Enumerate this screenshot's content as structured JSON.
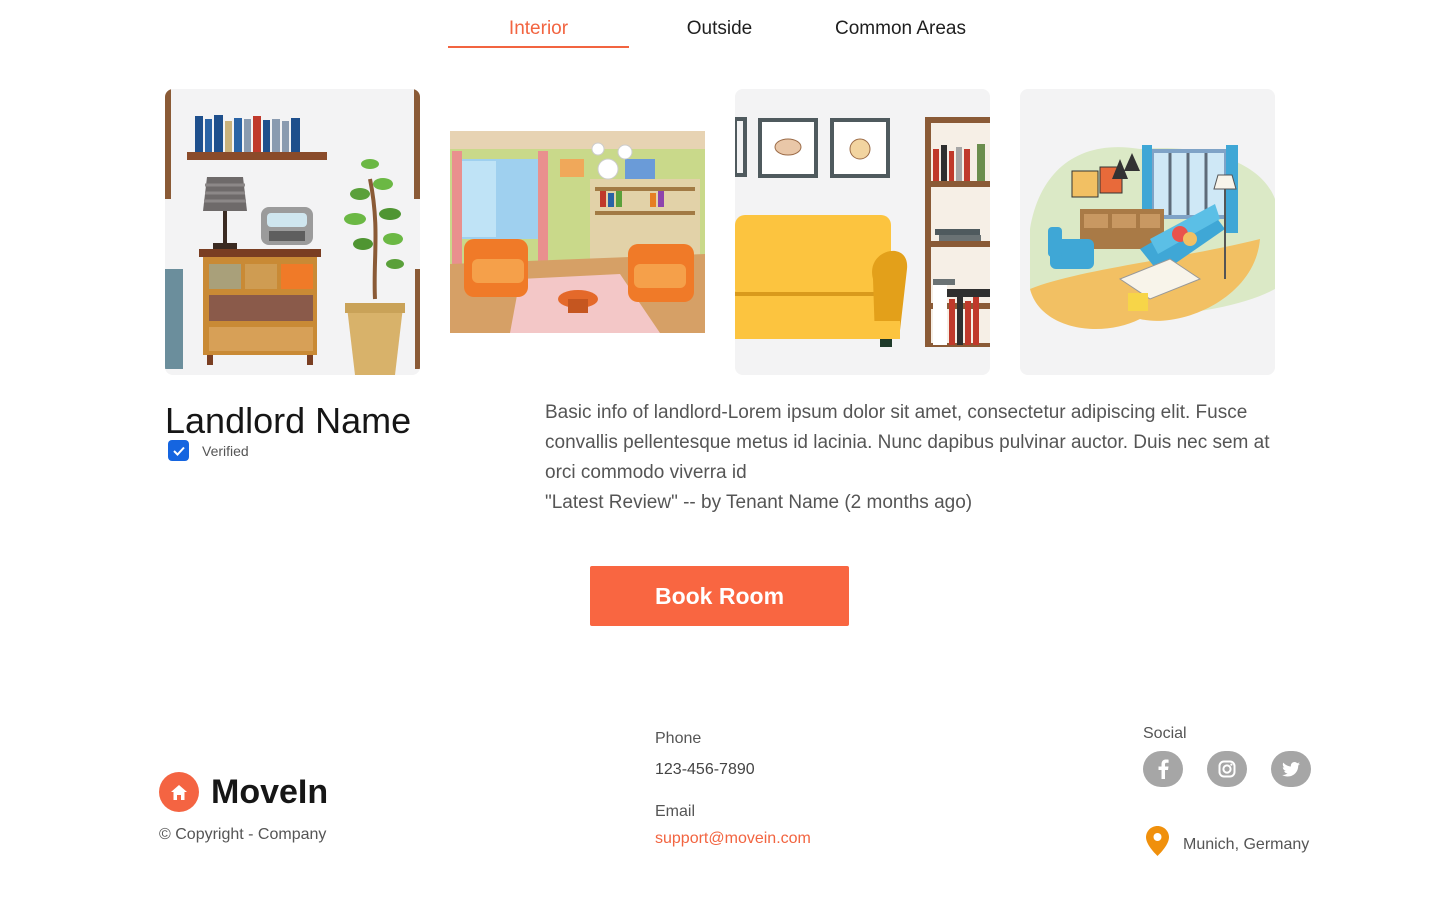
{
  "tabs": [
    {
      "label": "Interior",
      "active": true
    },
    {
      "label": "Outside",
      "active": false
    },
    {
      "label": "Common Areas",
      "active": false
    }
  ],
  "landlord": {
    "name": "Landlord Name",
    "verified": true,
    "verified_label": "Verified",
    "info": "Basic info of landlord-Lorem ipsum dolor sit amet, consectetur adipiscing elit. Fusce convallis pellentesque metus id lacinia. Nunc dapibus pulvinar auctor. Duis nec sem at orci commodo viverra id",
    "review": "\"Latest Review\" -- by Tenant Name (2 months ago)"
  },
  "book_button": "Book Room",
  "footer": {
    "brand": "MoveIn",
    "copyright": "© Copyright - Company",
    "phone_label": "Phone",
    "phone": "123-456-7890",
    "email_label": "Email",
    "email": "support@movein.com",
    "social_label": "Social",
    "socials": [
      "facebook-icon",
      "instagram-icon",
      "twitter-icon"
    ],
    "location": "Munich, Germany"
  },
  "colors": {
    "accent": "#f96641",
    "checkbox": "#1565e0",
    "social": "#a6a6a6",
    "location_pin": "#f0900c"
  }
}
